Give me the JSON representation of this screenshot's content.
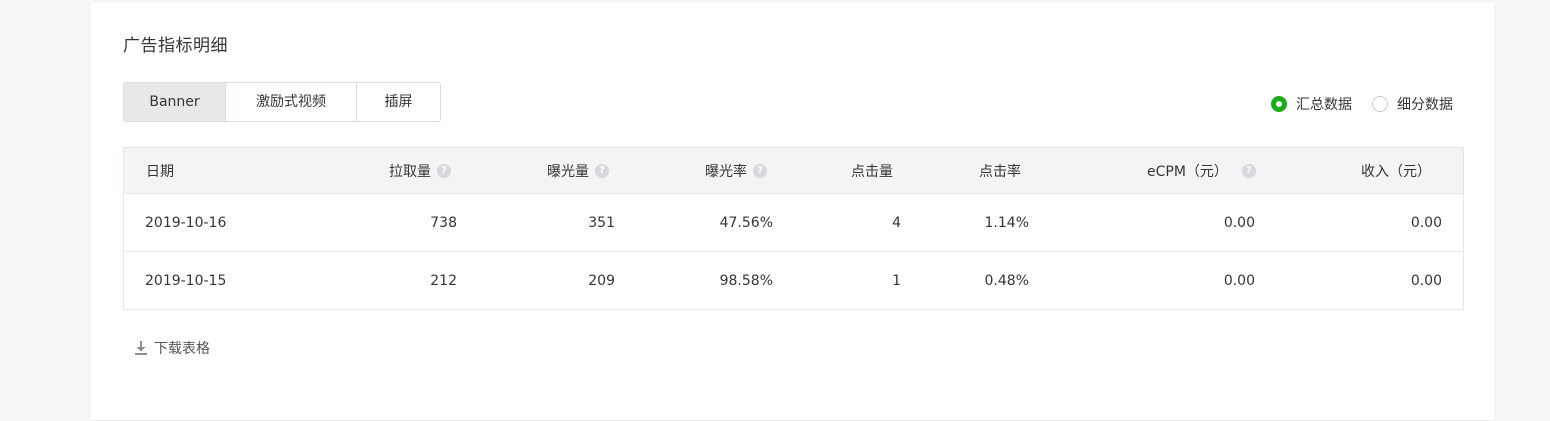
{
  "section_title": "广告指标明细",
  "tabs": [
    {
      "label": "Banner",
      "active": true
    },
    {
      "label": "激励式视频",
      "active": false
    },
    {
      "label": "插屏",
      "active": false
    }
  ],
  "view_mode": {
    "options": [
      {
        "label": "汇总数据",
        "checked": true
      },
      {
        "label": "细分数据",
        "checked": false
      }
    ]
  },
  "table": {
    "headers": {
      "date": "日期",
      "requests": "拉取量",
      "impressions": "曝光量",
      "impression_rate": "曝光率",
      "clicks": "点击量",
      "click_rate": "点击率",
      "ecpm": "eCPM（元）",
      "revenue": "收入（元）"
    },
    "help_glyph": "?",
    "rows": [
      {
        "date": "2019-10-16",
        "requests": "738",
        "impressions": "351",
        "impression_rate": "47.56%",
        "clicks": "4",
        "click_rate": "1.14%",
        "ecpm": "0.00",
        "revenue": "0.00"
      },
      {
        "date": "2019-10-15",
        "requests": "212",
        "impressions": "209",
        "impression_rate": "98.58%",
        "clicks": "1",
        "click_rate": "0.48%",
        "ecpm": "0.00",
        "revenue": "0.00"
      }
    ]
  },
  "download_label": "下载表格",
  "colors": {
    "accent": "#1aad19"
  }
}
